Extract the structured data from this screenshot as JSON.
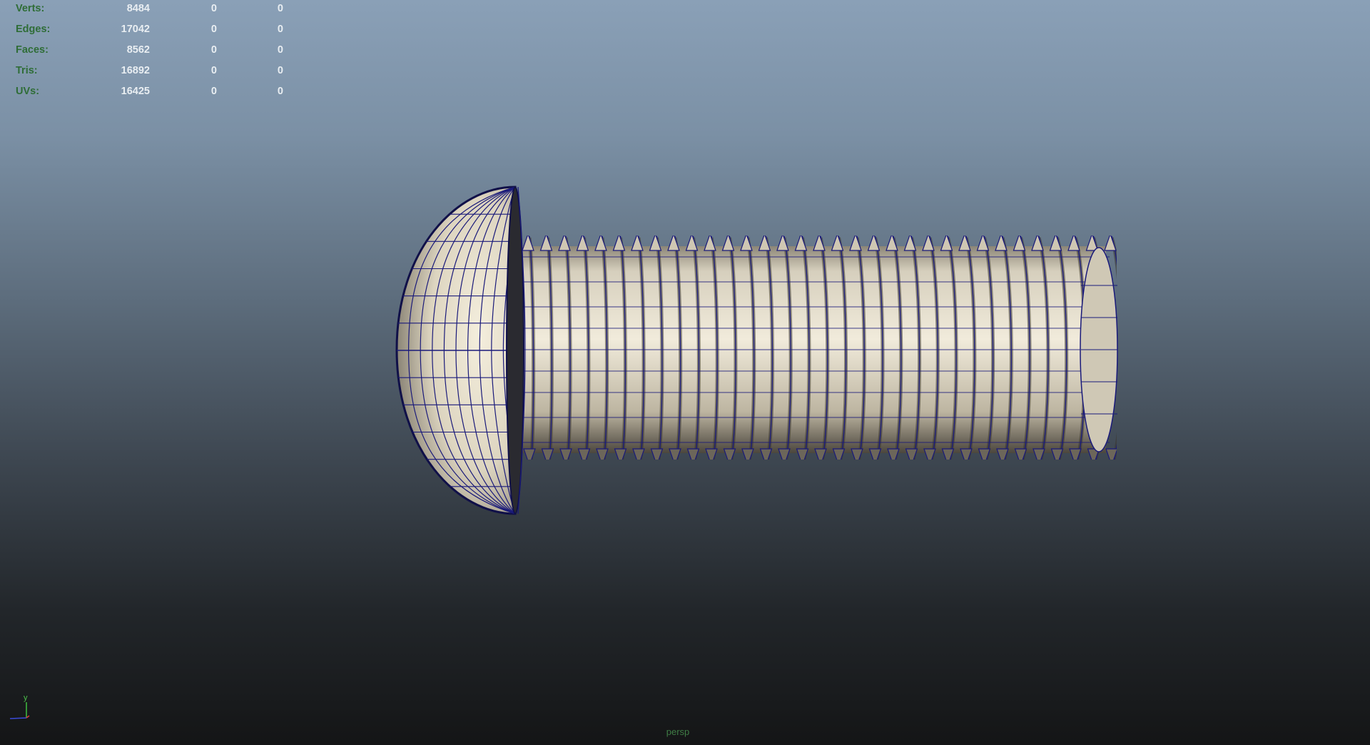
{
  "hud": {
    "rows": [
      {
        "label": "Verts:",
        "values": [
          "8484",
          "0",
          "0"
        ]
      },
      {
        "label": "Edges:",
        "values": [
          "17042",
          "0",
          "0"
        ]
      },
      {
        "label": "Faces:",
        "values": [
          "8562",
          "0",
          "0"
        ]
      },
      {
        "label": "Tris:",
        "values": [
          "16892",
          "0",
          "0"
        ]
      },
      {
        "label": "UVs:",
        "values": [
          "16425",
          "0",
          "0"
        ]
      }
    ]
  },
  "camera_label": "persp",
  "axis": {
    "y_label": "y"
  },
  "colors": {
    "hud_label": "#2f6d37",
    "hud_value": "#e9eef2",
    "wireframe": "#1a1a7a",
    "shaded_surface": "#e8e0cc"
  },
  "model": {
    "name_icon": "screw-bolt-model"
  }
}
